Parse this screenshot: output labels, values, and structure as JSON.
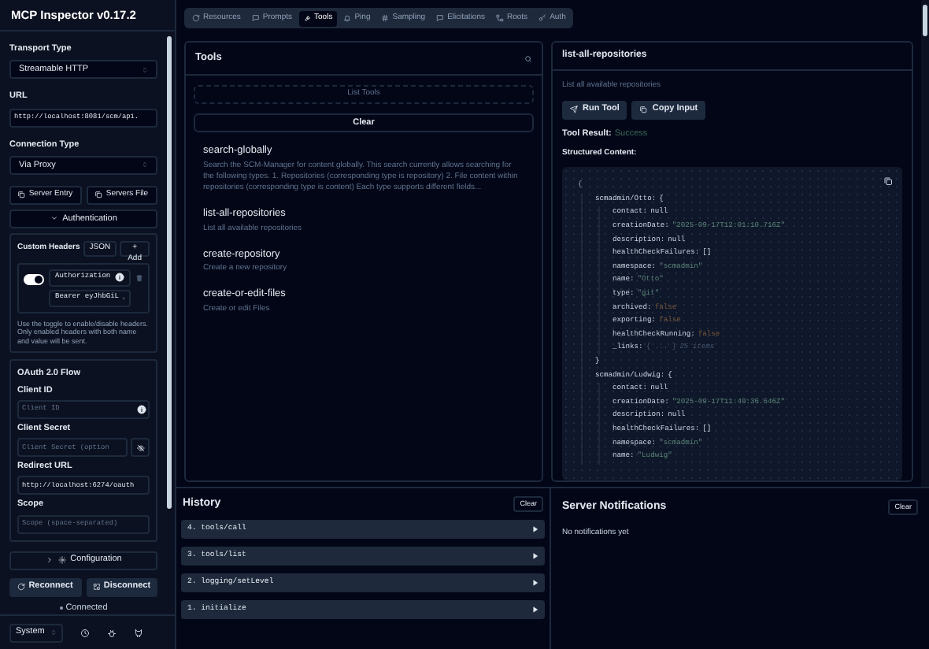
{
  "sidebar": {
    "title": "MCP Inspector v0.17.2",
    "transport_type": {
      "label": "Transport Type",
      "value": "Streamable HTTP"
    },
    "url": {
      "label": "URL",
      "value": "http://localhost:8081/scm/api."
    },
    "connection_type": {
      "label": "Connection Type",
      "value": "Via Proxy"
    },
    "config_buttons": [
      "Server Entry",
      "Servers File"
    ],
    "authentication": {
      "label": "Authentication",
      "expanded": true
    },
    "custom_headers": {
      "label": "Custom Headers",
      "json_button": "JSON",
      "add_button": "+ Add",
      "headers": [
        {
          "enabled": true,
          "name": "Authorization",
          "value": "Bearer eyJhbGiL"
        }
      ],
      "help": "Use the toggle to enable/disable headers. Only enabled headers with both name and value will be sent."
    },
    "oauth": {
      "title": "OAuth 2.0 Flow",
      "fields": [
        {
          "kind": "info",
          "label": "Client ID",
          "placeholder": "Client ID"
        },
        {
          "kind": "secret",
          "label": "Client Secret",
          "placeholder": "Client Secret (option"
        },
        {
          "kind": "plain",
          "label": "Redirect URL",
          "value": "http://localhost:6274/oauth"
        },
        {
          "kind": "plain",
          "label": "Scope",
          "placeholder": "Scope (space-separated)"
        }
      ]
    },
    "configuration": {
      "label": "Configuration",
      "expanded": false
    },
    "reconnect": "Reconnect",
    "disconnect": "Disconnect",
    "status": "Connected",
    "theme": "System"
  },
  "tabs": [
    {
      "label": "Resources",
      "selected": false
    },
    {
      "label": "Prompts",
      "selected": false
    },
    {
      "label": "Tools",
      "selected": true
    },
    {
      "label": "Ping",
      "selected": false
    },
    {
      "label": "Sampling",
      "selected": false
    },
    {
      "label": "Elicitations",
      "selected": false
    },
    {
      "label": "Roots",
      "selected": false
    },
    {
      "label": "Auth",
      "selected": false
    }
  ],
  "tools_panel": {
    "title": "Tools",
    "list_button": "List Tools",
    "clear_button": "Clear",
    "tools": [
      {
        "name": "search-globally",
        "description": "Search the SCM-Manager for content globally. This search currently allows searching for the following types. 1. Repositories (corresponding type is repository) 2. File content within repositories (corresponding type is content) Each type supports different fields..."
      },
      {
        "name": "list-all-repositories",
        "description": "List all available repositories"
      },
      {
        "name": "create-repository",
        "description": "Create a new repository"
      },
      {
        "name": "create-or-edit-files",
        "description": "Create or edit Files"
      }
    ]
  },
  "tool_detail": {
    "title": "list-all-repositories",
    "description": "List all available repositories",
    "run_button": "Run Tool",
    "copy_button": "Copy Input",
    "result_label": "Tool Result:",
    "result_status": "Success",
    "structured_label": "Structured Content:",
    "structured_content": {
      "open": "{",
      "entries": [
        {
          "key": "scmadmin/Otto:",
          "open": "{",
          "close": "}",
          "children": [
            {
              "key": "contact:",
              "kind": "null",
              "value": "null"
            },
            {
              "key": "creationDate:",
              "kind": "string",
              "value": "\"2025-09-17T12:01:10.716Z\""
            },
            {
              "key": "description:",
              "kind": "null",
              "value": "null"
            },
            {
              "key": "healthCheckFailures:",
              "kind": "array",
              "value": "[]"
            },
            {
              "key": "namespace:",
              "kind": "string",
              "value": "\"scmadmin\""
            },
            {
              "key": "name:",
              "kind": "string",
              "value": "\"Otto\""
            },
            {
              "key": "type:",
              "kind": "string",
              "value": "\"git\""
            },
            {
              "key": "archived:",
              "kind": "boolean",
              "value": "false"
            },
            {
              "key": "exporting:",
              "kind": "boolean",
              "value": "false"
            },
            {
              "key": "healthCheckRunning:",
              "kind": "boolean",
              "value": "false"
            },
            {
              "key": "_links:",
              "kind": "collapsed",
              "value": "{ ... }",
              "count": "25 items"
            }
          ]
        },
        {
          "key": "scmadmin/Ludwig:",
          "open": "{",
          "children": [
            {
              "key": "contact:",
              "kind": "null",
              "value": "null"
            },
            {
              "key": "creationDate:",
              "kind": "string",
              "value": "\"2025-09-17T11:49:36.646Z\""
            },
            {
              "key": "description:",
              "kind": "null",
              "value": "null"
            },
            {
              "key": "healthCheckFailures:",
              "kind": "array",
              "value": "[]"
            },
            {
              "key": "namespace:",
              "kind": "string",
              "value": "\"scmadmin\""
            },
            {
              "key": "name:",
              "kind": "string",
              "value": "\"Ludwig\""
            }
          ]
        }
      ]
    }
  },
  "history": {
    "title": "History",
    "clear_button": "Clear",
    "items": [
      "4. tools/call",
      "3. tools/list",
      "2. logging/setLevel",
      "1. initialize"
    ]
  },
  "notifications": {
    "title": "Server Notifications",
    "clear_button": "Clear",
    "empty_text": "No notifications yet"
  }
}
